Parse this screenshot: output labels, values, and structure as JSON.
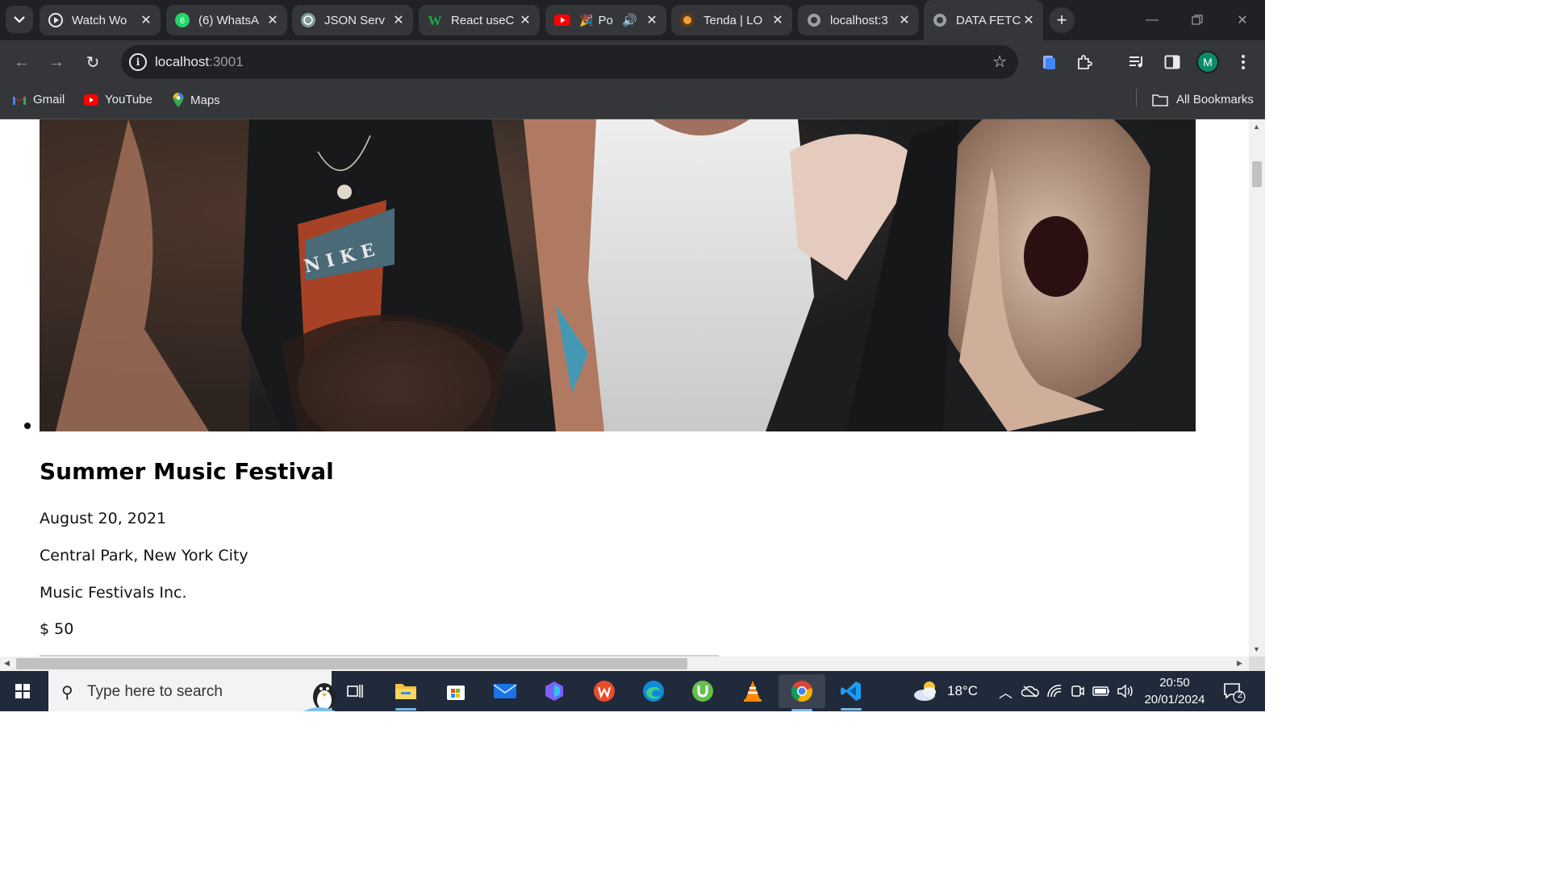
{
  "browser": {
    "tabs": [
      {
        "title": "Watch Wo",
        "favicon_color": "#ffffff",
        "favicon_icon": "play-circle-icon"
      },
      {
        "title": "(6) WhatsA",
        "favicon_color": "#25d366",
        "favicon_icon": "whatsapp-icon",
        "badge": "6"
      },
      {
        "title": "JSON Serv",
        "favicon_color": "#10a37f",
        "favicon_icon": "chatgpt-icon"
      },
      {
        "title": "React useC",
        "favicon_color": "#0a8a3a",
        "favicon_icon": "w-logo-icon"
      },
      {
        "title": "Po",
        "favicon_color": "#ff0000",
        "favicon_icon": "youtube-icon"
      },
      {
        "title": "Tenda | LO",
        "favicon_color": "#f0a030",
        "favicon_icon": "tenda-icon"
      },
      {
        "title": "localhost:3",
        "favicon_color": "#9aa0a6",
        "favicon_icon": "globe-icon"
      },
      {
        "title": "DATA FETC",
        "favicon_color": "#9aa0a6",
        "favicon_icon": "globe-icon"
      }
    ],
    "address": {
      "host": "localhost",
      "port": ":3001"
    },
    "profile_initial": "M",
    "bookmarks": [
      {
        "label": "Gmail",
        "icon": "gmail-icon"
      },
      {
        "label": "YouTube",
        "icon": "youtube-icon"
      },
      {
        "label": "Maps",
        "icon": "maps-icon"
      }
    ],
    "all_bookmarks_label": "All Bookmarks"
  },
  "event": {
    "title": "Summer Music Festival",
    "date": "August 20, 2021",
    "location": "Central Park, New York City",
    "organizer": "Music Festivals Inc.",
    "price": "$ 50"
  },
  "taskbar": {
    "search_placeholder": "Type here to search",
    "temperature": "18°C",
    "time": "20:50",
    "date": "20/01/2024",
    "notification_count": "2"
  },
  "colors": {
    "chrome_dark": "#202124",
    "chrome_toolbar": "#35363a",
    "taskbar": "#202a3a",
    "accent_profile": "#0b8a6a"
  }
}
